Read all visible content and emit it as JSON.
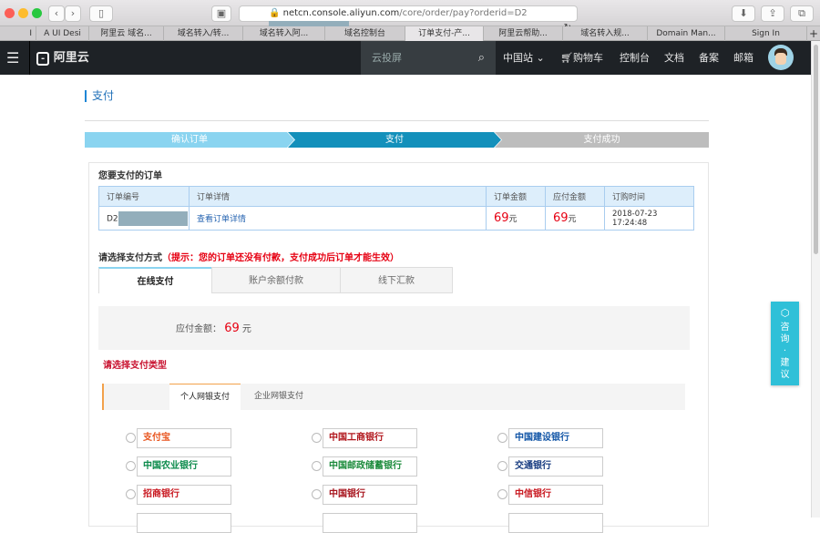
{
  "browser": {
    "url_main": "netcn.console.aliyun.com",
    "url_path": "/core/order/pay?orderid=D2",
    "tabs": [
      "I",
      "A UI Desi",
      "阿里云 域名...",
      "域名转入/转...",
      "域名转入阿...",
      "域名控制台",
      "订单支付-产...",
      "阿里云帮助...",
      "域名转入规...",
      "Domain Man...",
      "Sign In"
    ],
    "new_tab": "+"
  },
  "nav": {
    "logo": "阿里云",
    "search_placeholder": "云投屏",
    "region": "中国站",
    "cart": "购物车",
    "console": "控制台",
    "docs": "文档",
    "beian": "备案",
    "mail": "邮箱"
  },
  "page": {
    "title": "支付",
    "steps": [
      "确认订单",
      "支付",
      "支付成功"
    ],
    "order_heading": "您要支付的订单",
    "table": {
      "headers": [
        "订单编号",
        "订单详情",
        "订单金额",
        "应付金额",
        "订购时间"
      ],
      "row": {
        "order_no": "D2",
        "detail_link": "查看订单详情",
        "order_amount": "69",
        "payable_amount": "69",
        "unit": "元",
        "time": "2018-07-23 17:24:48"
      }
    },
    "method_heading": "请选择支付方式",
    "method_hint": "（提示：您的订单还没有付款，支付成功后订单才能生效）",
    "method_tabs": [
      "在线支付",
      "账户余额付款",
      "线下汇款"
    ],
    "payable_label": "应付金额：",
    "payable_value": "69",
    "payable_unit": "元",
    "type_heading": "请选择支付类型",
    "type_tabs": [
      "个人网银支付",
      "企业网银支付"
    ],
    "banks": [
      "支付宝",
      "中国工商银行",
      "中国建设银行",
      "中国农业银行",
      "中国邮政储蓄银行",
      "交通银行",
      "招商银行",
      "中国银行",
      "中信银行"
    ]
  },
  "widget": {
    "label": "咨询·建议"
  },
  "colors": {
    "step_done": "#8ad4f0",
    "step_active": "#1390bb",
    "step_todo": "#bdbdbd",
    "price": "#e60012",
    "widget": "#2fc0d8"
  }
}
